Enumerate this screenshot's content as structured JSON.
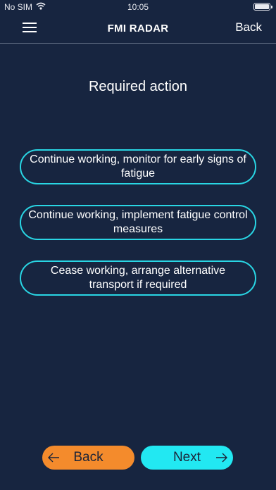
{
  "status": {
    "carrier": "No SIM",
    "wifi_icon": "wifi-icon",
    "time": "10:05",
    "battery_icon": "battery-icon",
    "battery_level": 1.0
  },
  "nav": {
    "menu_icon": "hamburger-menu-icon",
    "title": "FMI RADAR",
    "back_label": "Back"
  },
  "main": {
    "heading": "Required action",
    "options": [
      {
        "label": "Continue working, monitor for early signs of fatigue"
      },
      {
        "label": "Continue working, implement fatigue control measures"
      },
      {
        "label": "Cease working, arrange alternative transport if required"
      }
    ]
  },
  "footer": {
    "back_label": "Back",
    "back_icon": "arrow-left-icon",
    "next_label": "Next",
    "next_icon": "arrow-right-icon"
  },
  "colors": {
    "background": "#172540",
    "accent_cyan": "#22e8f2",
    "option_border": "#29d6e4",
    "back_orange": "#f48b2c"
  }
}
